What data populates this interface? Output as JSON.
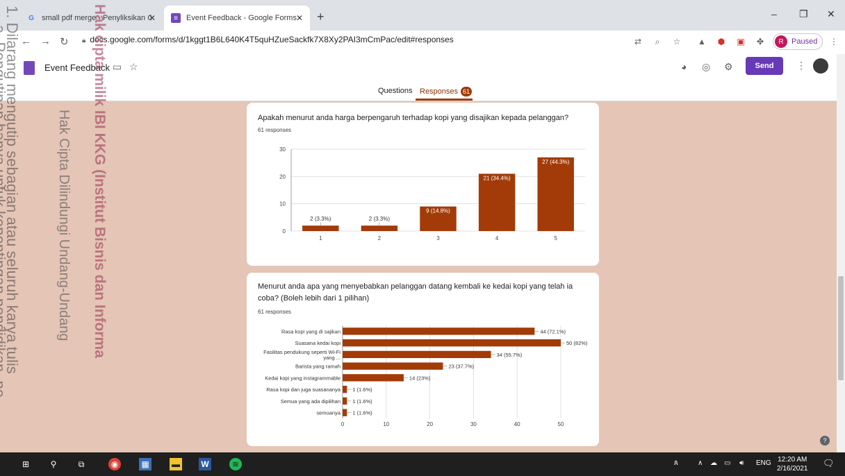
{
  "browser": {
    "tabs": [
      {
        "label": "small pdf merge - Penyliksikan G",
        "favicon": "G",
        "close": "✕"
      },
      {
        "label": "Event Feedback - Google Forms",
        "favicon": "≡",
        "close": "✕"
      }
    ],
    "new_tab": "+",
    "window": {
      "minimize": "–",
      "restore": "❐",
      "close": "✕"
    },
    "url": "docs.google.com/forms/d/1kggt1B6L640K4T5quHZueSackfk7X8Xy2PAI3mCmPac/edit#responses",
    "profile_initial": "R",
    "profile_status": "Paused"
  },
  "form": {
    "title": "Event Feedback",
    "send_label": "Send",
    "tabs": {
      "questions": "Questions",
      "responses": "Responses",
      "responses_count": "61"
    }
  },
  "questions": [
    {
      "title": "Apakah menurut anda harga berpengaruh terhadap kopi yang disajikan kepada pelanggan?",
      "responses": "61 responses"
    },
    {
      "title": "Menurut anda apa yang menyebabkan pelanggan datang kembali ke kedai kopi yang telah ia coba? (Boleh lebih dari 1 pilihan)",
      "responses": "61 responses"
    }
  ],
  "chart_data": [
    {
      "type": "bar",
      "orientation": "vertical",
      "categories": [
        "1",
        "2",
        "3",
        "4",
        "5"
      ],
      "values": [
        2,
        2,
        9,
        21,
        27
      ],
      "data_labels": [
        "2 (3.3%)",
        "2 (3.3%)",
        "9 (14.8%)",
        "21 (34.4%)",
        "27 (44.3%)"
      ],
      "ylim": [
        0,
        30
      ],
      "yticks": [
        0,
        10,
        20,
        30
      ],
      "grid": true,
      "color": "#a23b08"
    },
    {
      "type": "bar",
      "orientation": "horizontal",
      "categories": [
        "Rasa kopi yang di sajikan",
        "Suasana kedai kopi",
        "Fasilitas pendukung seperti Wi-Fi yang ...",
        "Barista yang ramah",
        "Kedai kopi yang instagrammable",
        "Rasa kopi dan juga suasananya",
        "Semua yang ada dipilihan",
        "semuanya"
      ],
      "values": [
        44,
        50,
        34,
        23,
        14,
        1,
        1,
        1
      ],
      "data_labels": [
        "44 (72.1%)",
        "50 (82%)",
        "34 (55.7%)",
        "23 (37.7%)",
        "14 (23%)",
        "1 (1.6%)",
        "1 (1.6%)",
        "1 (1.6%)"
      ],
      "xlim": [
        0,
        50
      ],
      "xticks": [
        0,
        10,
        20,
        30,
        40,
        50
      ],
      "grid": true,
      "color": "#a23b08"
    }
  ],
  "taskbar": {
    "time": "12:20 AM",
    "date": "2/16/2021",
    "language": "ENG"
  },
  "watermark": [
    "1. Dilarang mengutip sebagian atau seluruh karya tulis",
    "a. Pengutipan hanya untuk kepentingan pendidikan, pe",
    "Hak Cipta Dilindungi Undang-Undang",
    "Hak cipta milik IBI KKG (Institut Bisnis dan Informa"
  ],
  "colors": {
    "accent": "#673ab7",
    "bar": "#a23b08",
    "page_bg": "#e4c5b6"
  }
}
